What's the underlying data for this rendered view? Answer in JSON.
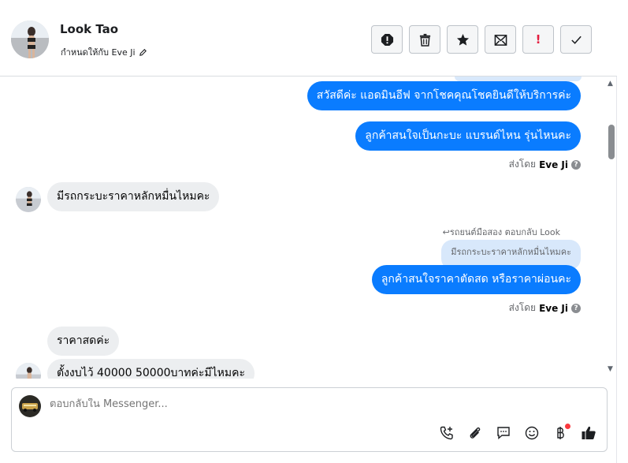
{
  "header": {
    "name": "Look Tao",
    "assigned_to": "กำหนดให้กับ Eve Ji",
    "actions": [
      "report-icon",
      "trash-icon",
      "star-icon",
      "mail-icon",
      "exclamation-icon",
      "check-icon"
    ],
    "important_label": "!"
  },
  "thread": {
    "messages": [
      {
        "dir": "out",
        "text": "สวัสดีค่ะ แอดมินอีฟ จากโชคคุณโชคยินดีให้บริการค่ะ"
      },
      {
        "dir": "out",
        "text": "ลูกค้าสนใจเป็นกะบะ แบรนด์ไหน รุ่นไหนคะ"
      },
      {
        "dir": "in",
        "text": "มีรถกระบะราคาหลักหมื่นไหมคะ"
      },
      {
        "dir": "out",
        "text": "ลูกค้าสนใจราคาตัดสด หรือราคาผ่อนคะ"
      },
      {
        "dir": "in",
        "text": "ราคาสดค่ะ"
      },
      {
        "dir": "in",
        "text": "ตั้งงบไว้ 40000 50000บาทค่ะมีไหมคะ"
      }
    ],
    "sent_by_prefix": "ส่งโดย",
    "sent_by_name": "Eve Ji",
    "help": "?",
    "reply_meta": "รถยนต์มือสอง ตอบกลับ Look",
    "quote_text": "มีรถกระบะราคาหลักหมื่นไหมคะ"
  },
  "composer": {
    "placeholder": "ตอบกลับใน Messenger...",
    "tools": [
      "call-add-icon",
      "attach-icon",
      "chat-bubble-icon",
      "emoji-icon",
      "baht-icon",
      "thumbs-up-icon"
    ]
  },
  "colors": {
    "accent": "#0a7cff",
    "incoming": "#eceef0",
    "quote": "#d8e8fb",
    "alert": "#e41e3f"
  }
}
